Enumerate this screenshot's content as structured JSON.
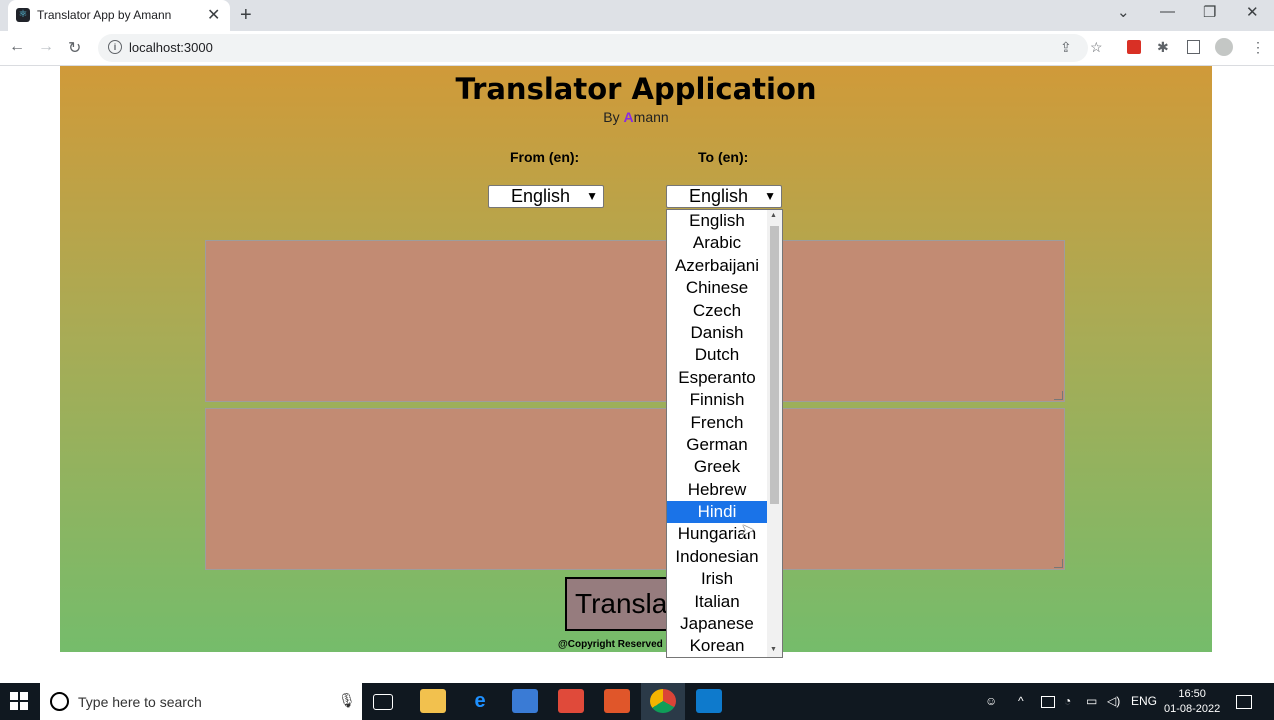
{
  "browser": {
    "tab_title": "Translator App by Amann",
    "tab_close": "✕",
    "new_tab": "+",
    "url": "localhost:3000",
    "window_controls": {
      "chevron": "⌄",
      "minimize": "—",
      "restore": "❐",
      "close": "✕"
    },
    "nav": {
      "back": "←",
      "forward": "→",
      "reload": "↻"
    }
  },
  "app": {
    "title": "Translator Application",
    "byline_prefix": "By ",
    "byline_accent": "A",
    "byline_rest": "mann",
    "from_label": "From (en):",
    "to_label": "To (en):",
    "from_value": "English",
    "to_value": "English",
    "translate_label": "Translate",
    "copyright": "@Copyright Reserved"
  },
  "dropdown": {
    "options": [
      "English",
      "Arabic",
      "Azerbaijani",
      "Chinese",
      "Czech",
      "Danish",
      "Dutch",
      "Esperanto",
      "Finnish",
      "French",
      "German",
      "Greek",
      "Hebrew",
      "Hindi",
      "Hungarian",
      "Indonesian",
      "Irish",
      "Italian",
      "Japanese",
      "Korean"
    ],
    "highlighted": "Hindi"
  },
  "taskbar": {
    "search_placeholder": "Type here to search",
    "lang": "ENG",
    "time": "16:50",
    "date": "01-08-2022"
  },
  "colors": {
    "accent_purple": "#8a2be2",
    "highlight_blue": "#1a73e8",
    "textarea_fill": "#c28b73"
  }
}
